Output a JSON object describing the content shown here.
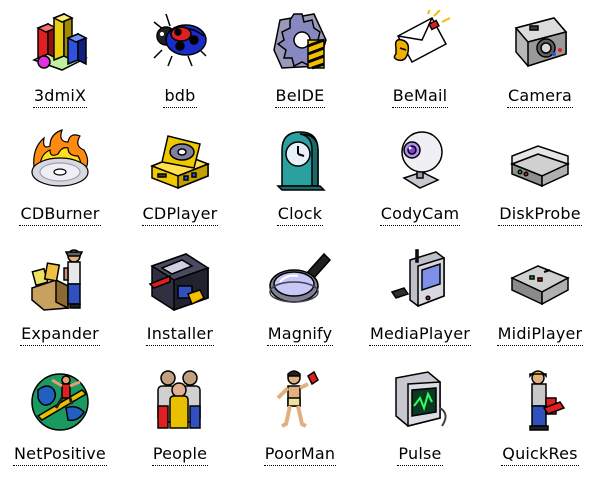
{
  "icons": [
    {
      "label": "3dmiX",
      "icon": "3d-bar-chart-icon"
    },
    {
      "label": "bdb",
      "icon": "ladybug-icon"
    },
    {
      "label": "BeIDE",
      "icon": "gear-icon"
    },
    {
      "label": "BeMail",
      "icon": "envelope-icon"
    },
    {
      "label": "Camera",
      "icon": "camera-icon"
    },
    {
      "label": "CDBurner",
      "icon": "flaming-cd-icon"
    },
    {
      "label": "CDPlayer",
      "icon": "cd-player-icon"
    },
    {
      "label": "Clock",
      "icon": "clock-icon"
    },
    {
      "label": "CodyCam",
      "icon": "webcam-icon"
    },
    {
      "label": "DiskProbe",
      "icon": "disk-drive-icon"
    },
    {
      "label": "Expander",
      "icon": "package-icon"
    },
    {
      "label": "Installer",
      "icon": "floppy-installer-icon"
    },
    {
      "label": "Magnify",
      "icon": "magnifying-glass-icon"
    },
    {
      "label": "MediaPlayer",
      "icon": "media-player-icon"
    },
    {
      "label": "MidiPlayer",
      "icon": "midi-box-icon"
    },
    {
      "label": "NetPositive",
      "icon": "globe-surfer-icon"
    },
    {
      "label": "People",
      "icon": "people-icon"
    },
    {
      "label": "PoorMan",
      "icon": "poorman-icon"
    },
    {
      "label": "Pulse",
      "icon": "pulse-monitor-icon"
    },
    {
      "label": "QuickRes",
      "icon": "quickres-icon"
    }
  ]
}
